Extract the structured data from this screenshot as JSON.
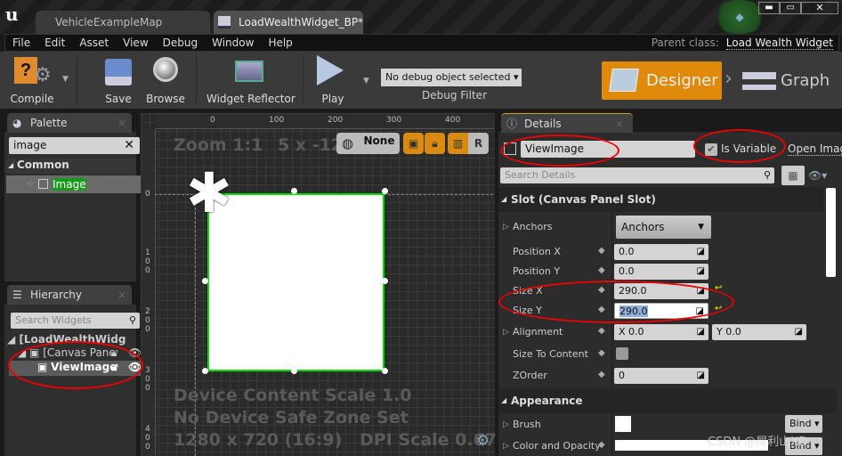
{
  "window": {
    "tabs": [
      {
        "label": "VehicleExampleMap"
      },
      {
        "label": "LoadWealthWidget_BP*"
      }
    ],
    "parent_class_label": "Parent class:",
    "parent_class": "Load Wealth Widget"
  },
  "menu": [
    "File",
    "Edit",
    "Asset",
    "View",
    "Debug",
    "Window",
    "Help"
  ],
  "toolbar": {
    "compile": "Compile",
    "save": "Save",
    "browse": "Browse",
    "widget_reflector": "Widget Reflector",
    "play": "Play",
    "debug_object": "No debug object selected",
    "debug_filter": "Debug Filter",
    "designer": "Designer",
    "graph": "Graph",
    "accent": "#e08a0c"
  },
  "palette": {
    "title": "Palette",
    "search": "image",
    "category": "Common",
    "items": [
      {
        "label": "Image"
      }
    ]
  },
  "hierarchy": {
    "title": "Hierarchy",
    "search_placeholder": "Search Widgets",
    "root": "[LoadWealthWidg",
    "canvas": "[Canvas Pane",
    "selected": "ViewImage"
  },
  "canvas": {
    "zoom": "Zoom 1:1",
    "coords": "5 x -127",
    "anchor_mode": "None",
    "r_label": "R",
    "ruler_top": [
      "0",
      "100",
      "200",
      "300",
      "400"
    ],
    "ruler_left": [
      "0",
      "100",
      "200",
      "300",
      "400"
    ],
    "device_scale": "Device Content Scale 1.0",
    "safe_zone": "No Device Safe Zone Set",
    "resolution": "1280 x 720 (16:9)",
    "dpi": "DPI Scale 0.67",
    "selection_color": "#00e000"
  },
  "details": {
    "title": "Details",
    "name": "ViewImage",
    "is_variable_label": "Is Variable",
    "is_variable": true,
    "open_link": "Open Imag",
    "search_placeholder": "Search Details",
    "slot_section": "Slot (Canvas Panel Slot)",
    "rows": {
      "anchors_label": "Anchors",
      "anchors_value": "Anchors",
      "pos_x_label": "Position X",
      "pos_x": "0.0",
      "pos_y_label": "Position Y",
      "pos_y": "0.0",
      "size_x_label": "Size X",
      "size_x": "290.0",
      "size_y_label": "Size Y",
      "size_y": "290.0",
      "alignment_label": "Alignment",
      "align_x": "X  0.0",
      "align_y": "Y  0.0",
      "size_to_content_label": "Size To Content",
      "size_to_content": false,
      "zorder_label": "ZOrder",
      "zorder": "0"
    },
    "appearance_section": "Appearance",
    "brush_label": "Brush",
    "color_label": "Color and Opacity",
    "bind": "Bind"
  },
  "watermark": "CSDN @犀利山XD"
}
